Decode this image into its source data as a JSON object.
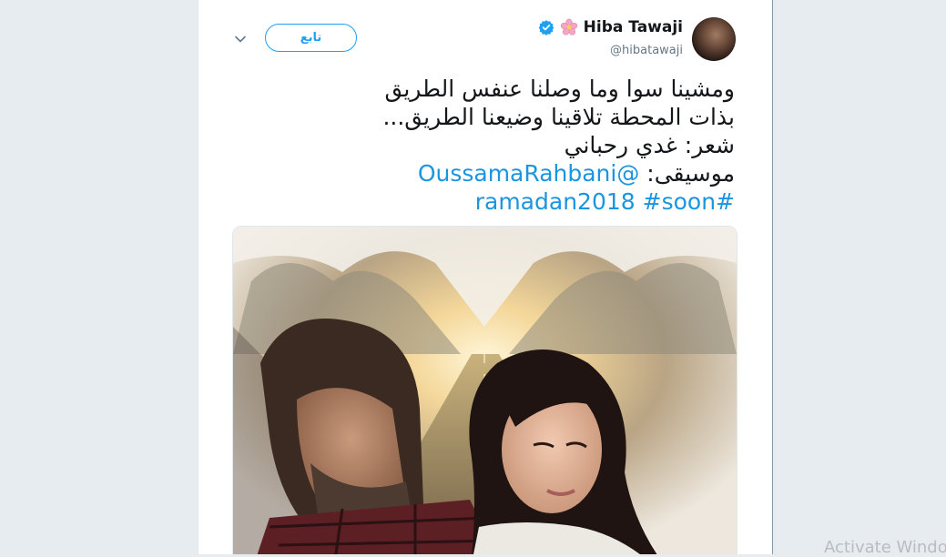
{
  "tweet": {
    "display_name": "Hiba Tawaji",
    "handle": "@hibatawaji",
    "follow_label": "تابع",
    "text_lines": [
      "ومشينا سوا وما وصلنا عنفس الطريق",
      "بذات المحطة تلاقينا وضيعنا الطريق...",
      "شعر: غدي رحباني"
    ],
    "music_label": "موسيقى: ",
    "mention": "@OussamaRahbani",
    "hashtags": [
      "#ramadan2018",
      "#soon"
    ]
  },
  "colors": {
    "accent": "#1da1f2",
    "link": "#1b95e0",
    "background": "#e6ecf0"
  },
  "icons": {
    "verified": "verified-badge-icon",
    "flower": "pink-flower-emoji-icon",
    "menu": "chevron-down-icon"
  },
  "system": {
    "watermark": "Activate Windo"
  }
}
